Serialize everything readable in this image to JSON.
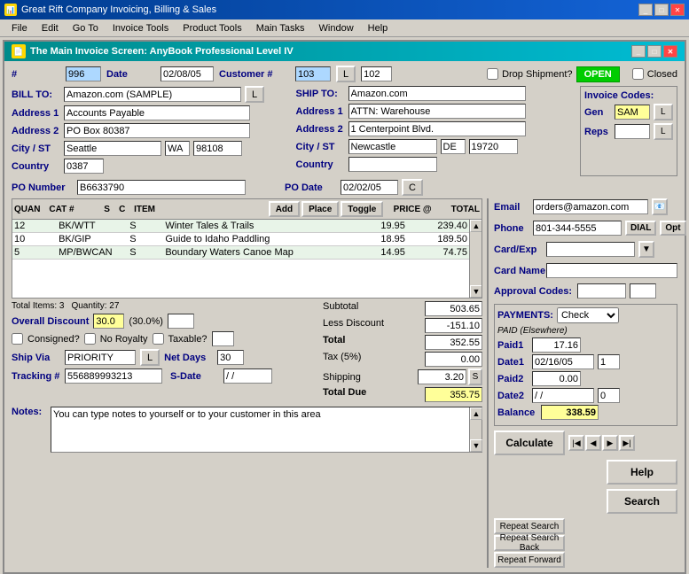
{
  "titleBar": {
    "title": "Great Rift Company Invoicing, Billing & Sales",
    "buttons": [
      "_",
      "□",
      "✕"
    ]
  },
  "menuBar": {
    "items": [
      "File",
      "Edit",
      "Go To",
      "Invoice Tools",
      "Product Tools",
      "Main Tasks",
      "Window",
      "Help"
    ]
  },
  "windowTitle": "The Main Invoice Screen: AnyBook Professional Level IV",
  "invoice": {
    "number_label": "#",
    "number": "996",
    "date_label": "Date",
    "date": "02/08/05",
    "customer_label": "Customer #",
    "customer_num": "103",
    "customer_L": "L",
    "customer_code": "102",
    "drop_shipment_label": "Drop Shipment?",
    "open_status": "OPEN",
    "closed_label": "Closed"
  },
  "billTo": {
    "label": "BILL TO:",
    "name": "Amazon.com (SAMPLE)",
    "L_btn": "L",
    "address1_label": "Address 1",
    "address1": "Accounts Payable",
    "address2_label": "Address 2",
    "address2": "PO Box 80387",
    "city_label": "City / ST",
    "city": "Seattle",
    "state": "WA",
    "zip": "98108",
    "country_label": "Country",
    "country_code": "0387"
  },
  "shipTo": {
    "label": "SHIP TO:",
    "name": "Amazon.com",
    "address1_label": "Address 1",
    "address1": "ATTN: Warehouse",
    "address2_label": "Address 2",
    "address2": "1 Centerpoint Blvd.",
    "city_label": "City / ST",
    "city": "Newcastle",
    "state": "DE",
    "zip": "19720",
    "country_label": "Country",
    "country": ""
  },
  "invoiceCodes": {
    "label": "Invoice Codes:",
    "gen_label": "Gen",
    "gen_value": "SAM",
    "reps_label": "Reps",
    "reps_value": ""
  },
  "po": {
    "number_label": "PO Number",
    "number": "B6633790",
    "date_label": "PO Date",
    "date": "02/02/05",
    "C_btn": "C"
  },
  "itemsTable": {
    "headers": [
      "QUAN",
      "CAT #",
      "S",
      "C",
      "ITEM",
      "PRICE @",
      "TOTAL"
    ],
    "add_btn": "Add",
    "place_btn": "Place",
    "toggle_btn": "Toggle",
    "rows": [
      {
        "quan": "12",
        "cat": "BK/WTT",
        "s": "S",
        "c": "",
        "item": "Winter Tales & Trails",
        "price": "19.95",
        "total": "239.40"
      },
      {
        "quan": "10",
        "cat": "BK/GIP",
        "s": "S",
        "c": "",
        "item": "Guide to Idaho Paddling",
        "price": "18.95",
        "total": "189.50"
      },
      {
        "quan": "5",
        "cat": "MP/BWCAN",
        "s": "S",
        "c": "",
        "item": "Boundary Waters Canoe Map",
        "price": "14.95",
        "total": "74.75"
      }
    ]
  },
  "totals": {
    "items_label": "Total Items: 3",
    "quantity_label": "Quantity: 27",
    "overall_discount_label": "Overall Discount",
    "discount_value": "30.0",
    "discount_pct": "(30.0%)",
    "subtotal_label": "Subtotal",
    "subtotal": "503.65",
    "less_discount_label": "Less Discount",
    "less_discount": "-151.10",
    "total_label": "Total",
    "total": "352.55",
    "tax_label": "Tax (5%)",
    "tax": "0.00",
    "shipping_label": "Shipping",
    "shipping": "3.20",
    "total_due_label": "Total Due",
    "total_due": "355.75"
  },
  "options": {
    "consigned_label": "Consigned?",
    "no_royalty_label": "No Royalty",
    "taxable_label": "Taxable?",
    "ship_via_label": "Ship Via",
    "ship_via": "PRIORITY",
    "L_btn": "L",
    "net_days_label": "Net Days",
    "net_days": "30",
    "tracking_label": "Tracking #",
    "tracking": "556889993213",
    "s_date_label": "S-Date",
    "s_date": "/ /"
  },
  "rightPanel": {
    "email_label": "Email",
    "email": "orders@amazon.com",
    "phone_label": "Phone",
    "phone": "801-344-5555",
    "dial_btn": "DIAL",
    "opt_btn": "Opt",
    "card_exp_label": "Card/Exp",
    "card_name_label": "Card Name",
    "approval_label": "Approval Codes:",
    "payments_label": "PAYMENTS:",
    "payment_type": "Check",
    "paid_elsewhere_label": "PAID (Elsewhere)",
    "paid1_label": "Paid1",
    "paid1": "17.16",
    "date1_label": "Date1",
    "date1": "02/16/05",
    "date1_num": "1",
    "paid2_label": "Paid2",
    "paid2": "0.00",
    "date2_label": "Date2",
    "date2": "/ /",
    "date2_num": "0",
    "balance_label": "Balance",
    "balance": "338.59",
    "calculate_btn": "Calculate",
    "help_btn": "Help",
    "search_btn": "Search",
    "repeat_search_btn": "Repeat Search",
    "repeat_search_back_btn": "Repeat Search Back",
    "repeat_forward_btn": "Repeat Forward"
  },
  "notes": {
    "label": "Notes:",
    "text": "You can type notes to yourself or to your customer in this area"
  }
}
